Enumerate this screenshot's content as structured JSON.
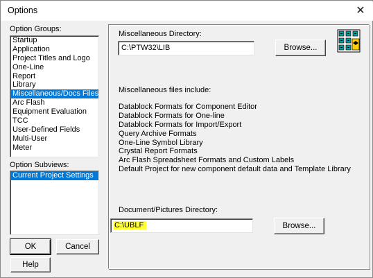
{
  "window": {
    "title": "Options"
  },
  "left": {
    "groups_label": "Option Groups:",
    "groups": [
      "Startup",
      "Application",
      "Project Titles and Logo",
      "One-Line",
      "Report",
      "Library",
      "Miscellaneous/Docs Files",
      "Arc Flash",
      "Equipment Evaluation",
      "TCC",
      "User-Defined Fields",
      "Multi-User",
      "Meter"
    ],
    "selected_group": "Miscellaneous/Docs Files",
    "subviews_label": "Option Subviews:",
    "subviews": [
      "Current Project Settings"
    ],
    "ok_label": "OK",
    "cancel_label": "Cancel",
    "help_label": "Help"
  },
  "main": {
    "misc_dir_label": "Miscellaneous Directory:",
    "misc_dir_value": "C:\\PTW32\\LIB",
    "browse_label": "Browse...",
    "files_heading": "Miscellaneous files include:",
    "files": [
      "Datablock Formats for Component Editor",
      "Datablock Formats for One-line",
      "Datablock Formats for Import/Export",
      "Query Archive Formats",
      "One-Line Symbol Library",
      "Crystal Report Formats",
      "Arc Flash Spreadsheet Formats and Custom Labels",
      "Default Project for new component default data and Template Library"
    ],
    "doc_dir_label": "Document/Pictures Directory:",
    "doc_dir_value": "C:\\UBLF",
    "doc_dir_highlight": "#ffff33",
    "browse2_label": "Browse...",
    "icon": "files-cabinet-icon"
  },
  "colors": {
    "selection": "#0078d7",
    "dialog_bg": "#f0f0f0"
  }
}
